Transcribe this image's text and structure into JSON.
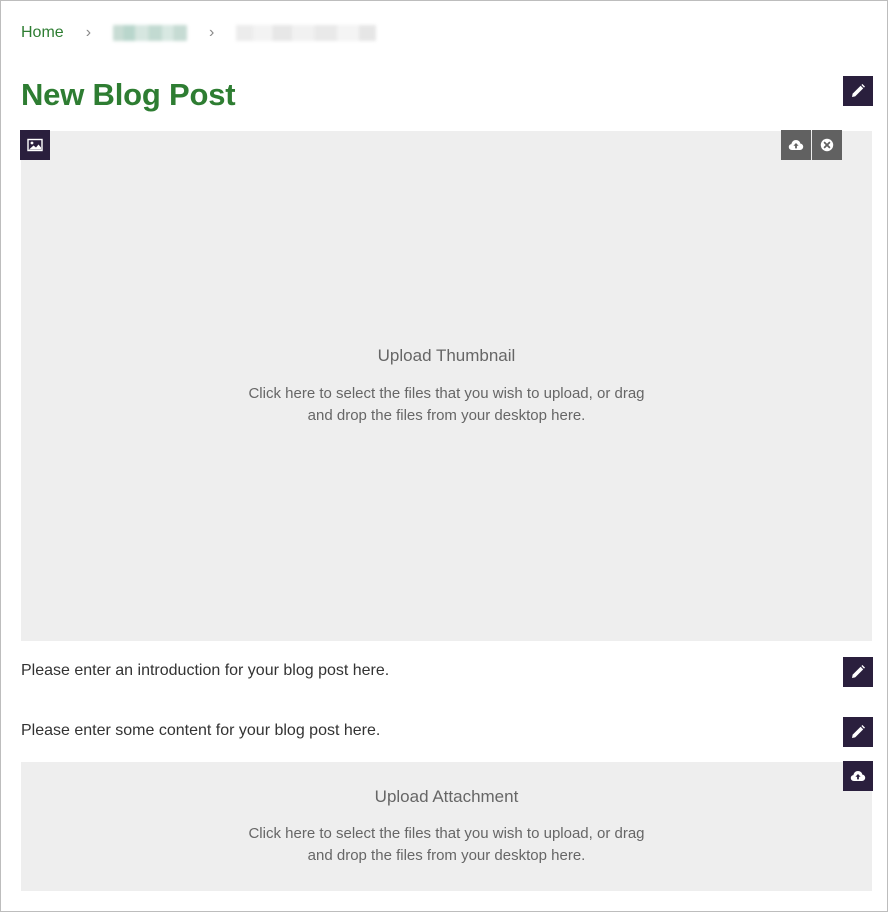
{
  "breadcrumb": {
    "home": "Home",
    "separator": "›"
  },
  "page": {
    "title": "New Blog Post"
  },
  "thumbnail_upload": {
    "title": "Upload Thumbnail",
    "description": "Click here to select the files that you wish to upload, or drag and drop the files from your desktop here."
  },
  "introduction": {
    "placeholder": "Please enter an introduction for your blog post here."
  },
  "content": {
    "placeholder": "Please enter some content for your blog post here."
  },
  "attachment_upload": {
    "title": "Upload Attachment",
    "description": "Click here to select the files that you wish to upload, or drag and drop the files from your desktop here."
  },
  "icons": {
    "edit": "pencil-icon",
    "image": "image-icon",
    "upload": "cloud-upload-icon",
    "remove": "close-circle-icon"
  },
  "colors": {
    "brand_green": "#2e7d32",
    "button_dark": "#2a1f3d",
    "button_grey": "#616161",
    "dropzone_bg": "#eeeeee"
  }
}
